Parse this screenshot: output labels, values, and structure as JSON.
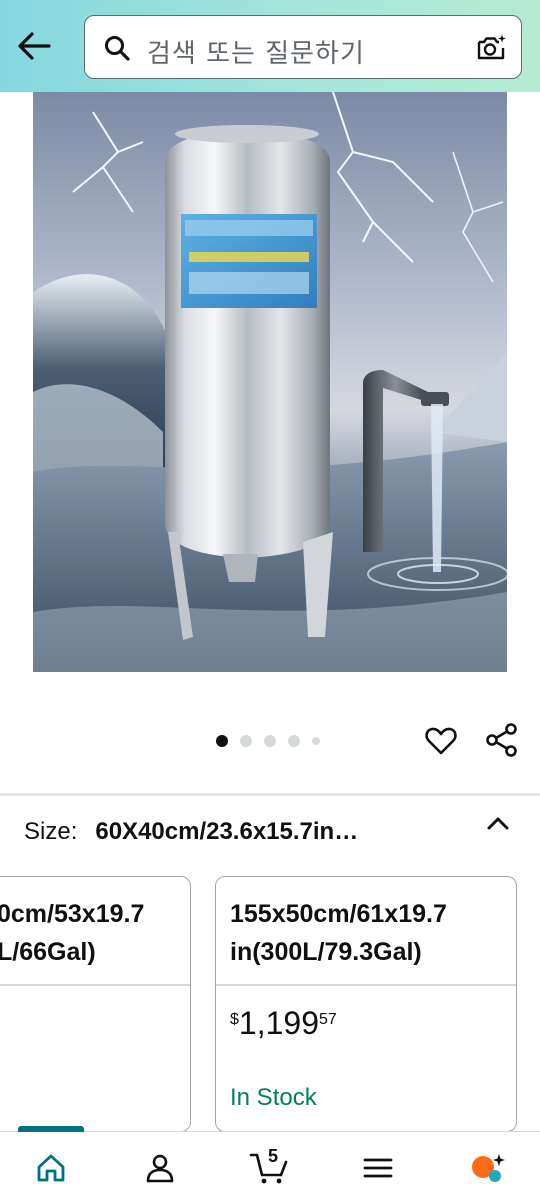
{
  "header": {
    "search_placeholder": "검색 또는 질문하기"
  },
  "carousel": {
    "total_images": 5,
    "active_index": 0
  },
  "size_selector": {
    "label": "Size:",
    "selected_value": "60X40cm/23.6x15.7in…"
  },
  "options": [
    {
      "title_line1": "0cm/53x19.7",
      "title_line2": "L/66Gal)"
    },
    {
      "title_line1": "155x50cm/61x19.7",
      "title_line2": "in(300L/79.3Gal)",
      "price_symbol": "$",
      "price_whole": "1,199",
      "price_fraction": "57",
      "availability": "In Stock"
    }
  ],
  "bottom_nav": {
    "cart_count": "5",
    "items": [
      "home-icon",
      "account-icon",
      "cart-icon",
      "menu-icon",
      "rufus-icon"
    ]
  },
  "colors": {
    "accent": "#007185",
    "in_stock": "#067d62",
    "rufus_orange": "#ff6a1a",
    "rufus_teal": "#1fa9c1"
  }
}
